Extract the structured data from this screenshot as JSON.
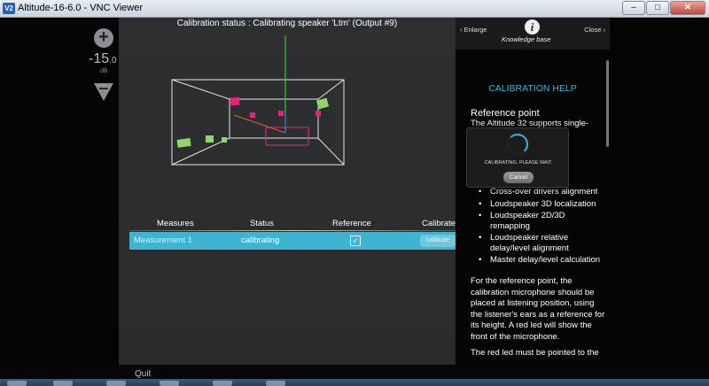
{
  "window": {
    "title": "Altitude-16-6.0 - VNC Viewer",
    "logo": "V2",
    "min": "–",
    "max": "□",
    "close": "✕"
  },
  "volume": {
    "plus": "+",
    "value": "-15",
    "decimal": ".0",
    "unit": "dB"
  },
  "calibration_status": "Calibrating speaker 'Ltm' (Output #9)",
  "calibration_status_prefix": "Calibration status : ",
  "table": {
    "headers": {
      "measures": "Measures",
      "status": "Status",
      "reference": "Reference",
      "calibrate": "Calibrate"
    },
    "rows": [
      {
        "name": "Measurement 1",
        "status": "calibrating",
        "reference_checked": "✓",
        "calibrate": "calibrate"
      }
    ]
  },
  "footer": {
    "quit": "Quit"
  },
  "knowledge_base": {
    "enlarge": "Enlarge",
    "close": "Close",
    "info_glyph": "i",
    "title": "Knowledge base",
    "help_title": "CALIBRATION HELP",
    "ref_point_title": "Reference point",
    "intro": "The Altitude 32 supports single-",
    "bullets": [
      "Cross-over drivers alignment",
      "Loudspeaker 3D localization",
      "Loudspeaker 2D/3D remapping",
      "Loudspeaker relative delay/level alignment",
      "Master delay/level calculation"
    ],
    "para2": "For the reference point, the calibration microphone should be placed at listening position, using the listener's ears as a reference for its height. A red led will show the front of the microphone.",
    "para3": "The red led must be pointed to the"
  },
  "modal": {
    "text": "CALIBRATING. PLEASE WAIT.",
    "cancel": "Cancel"
  },
  "colors": {
    "accent": "#3fb4d2",
    "help_title": "#38b8dc",
    "speaker_magenta": "#e8227a",
    "speaker_green": "#8fd46a"
  }
}
